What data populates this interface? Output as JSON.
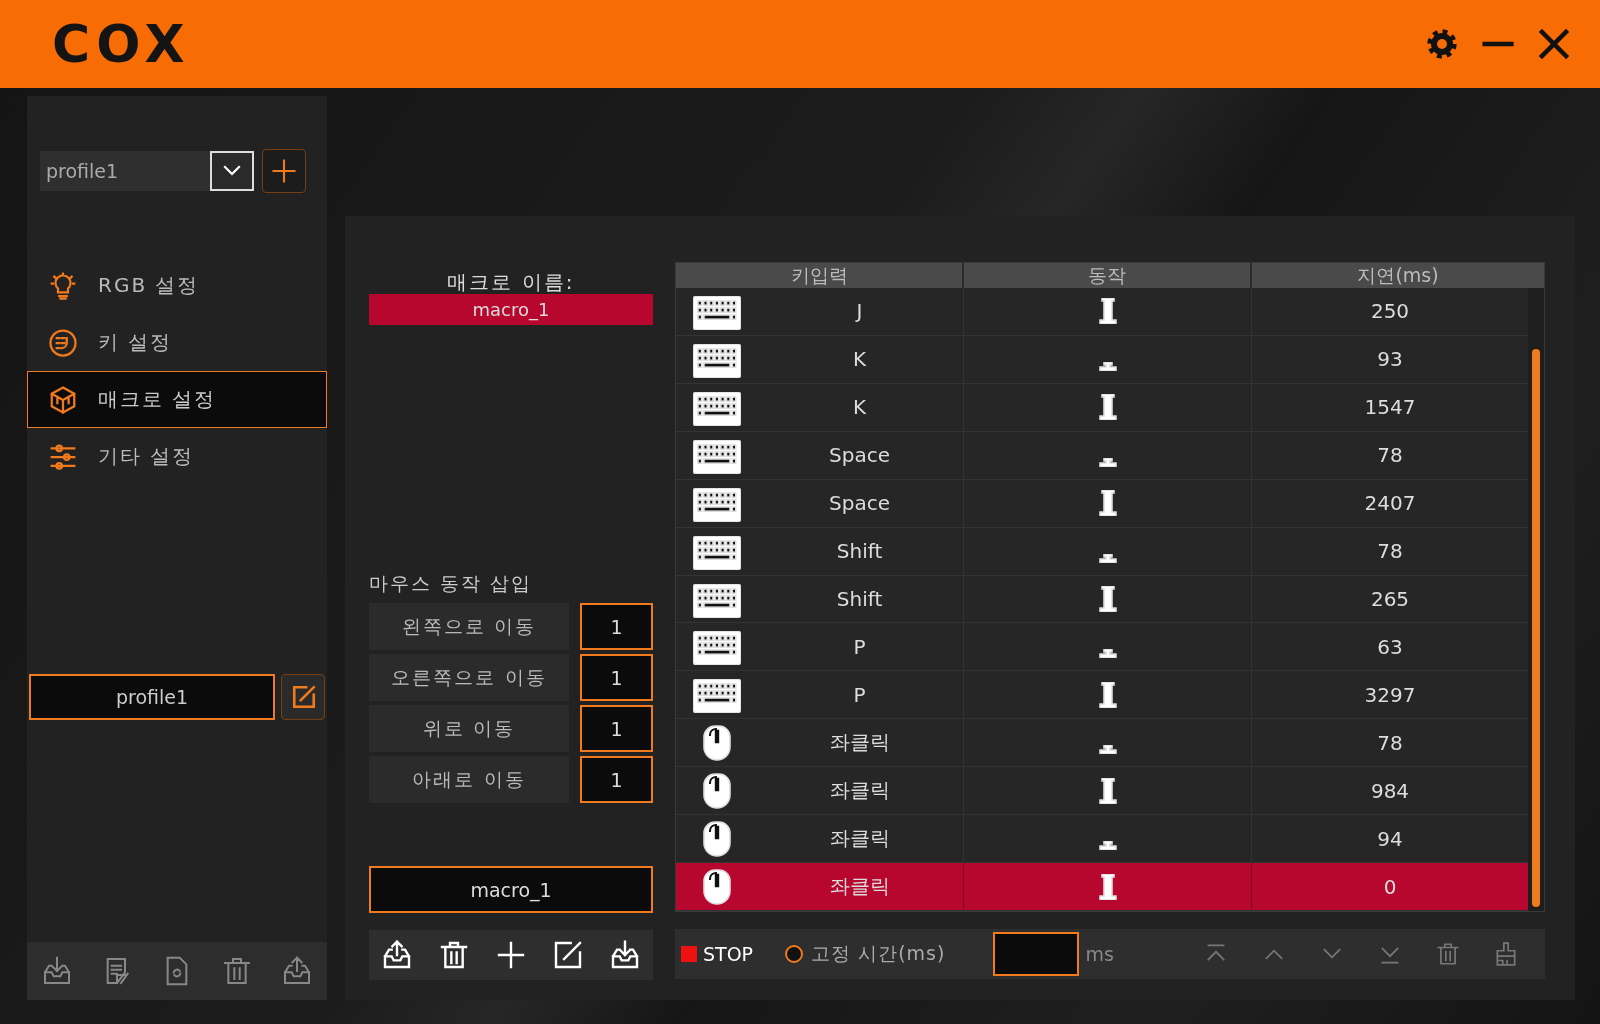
{
  "header": {
    "logo": "COX"
  },
  "sidebar": {
    "profile_select": {
      "value": "profile1"
    },
    "nav": [
      {
        "kind": "bulb",
        "label": "RGB 설정",
        "selected": false
      },
      {
        "kind": "keypad",
        "label": "키 설정",
        "selected": false
      },
      {
        "kind": "cube",
        "label": "매크로 설정",
        "selected": true
      },
      {
        "kind": "sliders",
        "label": "기타 설정",
        "selected": false
      }
    ],
    "profile_name": {
      "value": "profile1"
    }
  },
  "macro": {
    "name_label": "매크로 이름:",
    "selected_name": "macro_1",
    "mouse_insert_label": "마우스 동작 삽입",
    "mouse_moves": [
      {
        "label": "왼쪽으로 이동",
        "value": "1"
      },
      {
        "label": "오른쪽으로 이동",
        "value": "1"
      },
      {
        "label": "위로 이동",
        "value": "1"
      },
      {
        "label": "아래로 이동",
        "value": "1"
      }
    ],
    "name_field": {
      "value": "macro_1"
    }
  },
  "table": {
    "columns": [
      "키입력",
      "동작",
      "지연(ms)"
    ],
    "rows": [
      {
        "kind": "keyboard",
        "key": "J",
        "pressed": true,
        "delay": "250",
        "selected": false
      },
      {
        "kind": "keyboard",
        "key": "K",
        "pressed": false,
        "delay": "93",
        "selected": false
      },
      {
        "kind": "keyboard",
        "key": "K",
        "pressed": true,
        "delay": "1547",
        "selected": false
      },
      {
        "kind": "keyboard",
        "key": "Space",
        "pressed": false,
        "delay": "78",
        "selected": false
      },
      {
        "kind": "keyboard",
        "key": "Space",
        "pressed": true,
        "delay": "2407",
        "selected": false
      },
      {
        "kind": "keyboard",
        "key": "Shift",
        "pressed": false,
        "delay": "78",
        "selected": false
      },
      {
        "kind": "keyboard",
        "key": "Shift",
        "pressed": true,
        "delay": "265",
        "selected": false
      },
      {
        "kind": "keyboard",
        "key": "P",
        "pressed": false,
        "delay": "63",
        "selected": false
      },
      {
        "kind": "keyboard",
        "key": "P",
        "pressed": true,
        "delay": "3297",
        "selected": false
      },
      {
        "kind": "mouse",
        "key": "좌클릭",
        "pressed": false,
        "delay": "78",
        "selected": false
      },
      {
        "kind": "mouse",
        "key": "좌클릭",
        "pressed": true,
        "delay": "984",
        "selected": false
      },
      {
        "kind": "mouse",
        "key": "좌클릭",
        "pressed": false,
        "delay": "94",
        "selected": false
      },
      {
        "kind": "mouse",
        "key": "좌클릭",
        "pressed": true,
        "delay": "0",
        "selected": true
      }
    ]
  },
  "controls": {
    "stop": "STOP",
    "fixed_time": {
      "label": "고정 시간(ms)",
      "checked": false
    },
    "unit": "ms"
  }
}
